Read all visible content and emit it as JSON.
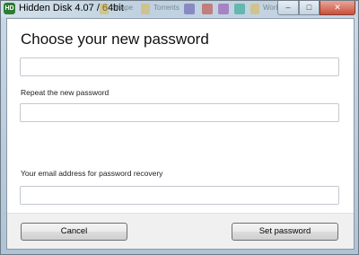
{
  "window": {
    "title": "Hidden Disk 4.07 / 64bit",
    "app_icon_text": "HD",
    "background_tabs": [
      "Shape",
      "Torrents",
      "Work"
    ],
    "controls": {
      "minimize": "–",
      "maximize": "□",
      "close": "✕"
    }
  },
  "dialog": {
    "heading": "Choose your new password",
    "password_value": "",
    "repeat_label": "Repeat the new password",
    "repeat_value": "",
    "email_label": "Your email address for password recovery",
    "email_value": ""
  },
  "footer": {
    "cancel_label": "Cancel",
    "set_password_label": "Set password"
  },
  "colors": {
    "accent_icon": "#2e7d32",
    "close_button": "#c8503b"
  }
}
